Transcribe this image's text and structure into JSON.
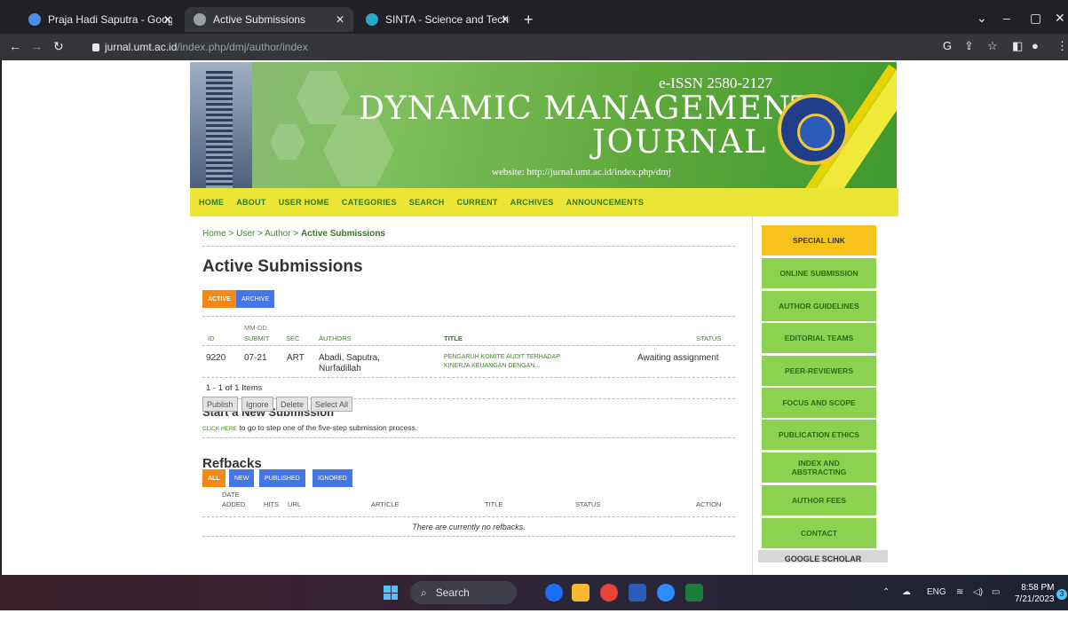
{
  "browser": {
    "tabs": [
      {
        "label": "Praja Hadi Saputra - Google Scho",
        "active": false
      },
      {
        "label": "Active Submissions",
        "active": true
      },
      {
        "label": "SINTA - Science and Technology",
        "active": false
      }
    ],
    "address": {
      "domain": "jurnal.umt.ac.id",
      "path": "/index.php/dmj/author/index"
    }
  },
  "banner": {
    "eissn": "e-ISSN 2580-2127",
    "title_line1": "DYNAMIC MANAGEMENT",
    "title_line2": "JOURNAL",
    "website": "website: http://jurnal.umt.ac.id/index.php/dmj"
  },
  "menu": [
    "HOME",
    "ABOUT",
    "USER HOME",
    "CATEGORIES",
    "SEARCH",
    "CURRENT",
    "ARCHIVES",
    "ANNOUNCEMENTS"
  ],
  "breadcrumb": {
    "home": "Home",
    "sep": " > ",
    "user": "User",
    "author": "Author",
    "current": "Active Submissions"
  },
  "page_title": "Active Submissions",
  "submission_tabs": {
    "active": "Active",
    "archive": "Archive"
  },
  "table": {
    "headers": {
      "id": "ID",
      "date_line1": "MM-DD",
      "date_line2": "SUBMIT",
      "sec": "SEC",
      "authors": "AUTHORS",
      "title": "TITLE",
      "status": "STATUS"
    },
    "rows": [
      {
        "id": "9220",
        "date": "07-21",
        "sec": "ART",
        "authors_line1": "Abadi, Saputra,",
        "authors_line2": "Nurfadillah",
        "title_line1": "PENGARUH KOMITE AUDIT TERHADAP",
        "title_line2": "KINERJA KEUANGAN DENGAN...",
        "status": "Awaiting assignment"
      }
    ],
    "count": "1 - 1 of 1 Items"
  },
  "new_submission": {
    "heading": "Start a New Submission",
    "link": "CLICK HERE",
    "text": " to go to step one of the five-step submission process."
  },
  "refbacks": {
    "heading": "Refbacks",
    "tabs": [
      "All",
      "New",
      "Published",
      "Ignored"
    ],
    "headers": {
      "date_line1": "DATE",
      "date_line2": "ADDED",
      "hits": "HITS",
      "url": "URL",
      "article": "ARTICLE",
      "title": "TITLE",
      "status": "STATUS",
      "action": "ACTION"
    },
    "empty": "There are currently no refbacks.",
    "buttons": [
      "Publish",
      "Ignore",
      "Delete",
      "Select All"
    ]
  },
  "sidebar": [
    {
      "label": "SPECIAL LINK"
    },
    {
      "label": "ONLINE SUBMISSION"
    },
    {
      "label": "AUTHOR GUIDELINES"
    },
    {
      "label": "EDITORIAL TEAMS"
    },
    {
      "label": "PEER-REVIEWERS"
    },
    {
      "label": "FOCUS AND SCOPE"
    },
    {
      "label": "PUBLICATION ETHICS"
    },
    {
      "label_line1": "INDEX AND",
      "label_line2": "ABSTRACTING"
    },
    {
      "label": "AUTHOR FEES"
    },
    {
      "label": "CONTACT"
    },
    {
      "label": "GOOGLE SCHOLAR"
    }
  ],
  "taskbar": {
    "search": "Search",
    "lang": "ENG",
    "time": "8:58 PM",
    "date": "7/21/2023",
    "notifications": "3"
  },
  "colors": {
    "menu_bg": "#ebe535",
    "link_green": "#3a8a1e",
    "sidebar_green": "#8cd14f",
    "special_yellow": "#f7c21b",
    "tab_orange": "#f38a16",
    "tab_blue": "#4476e8"
  }
}
